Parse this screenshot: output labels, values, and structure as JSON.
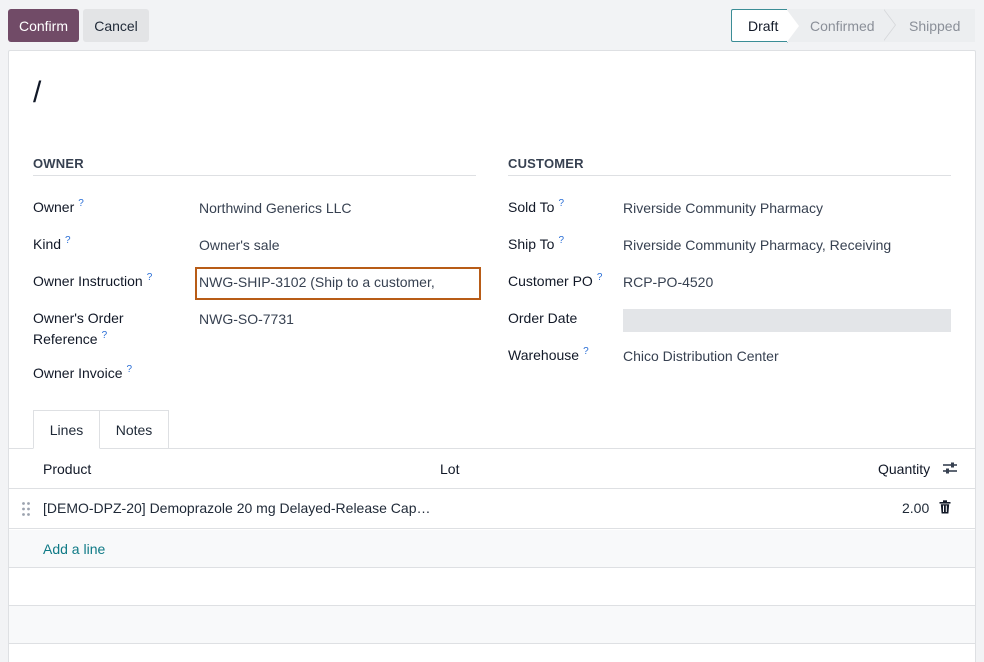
{
  "toolbar": {
    "confirm_label": "Confirm",
    "cancel_label": "Cancel"
  },
  "status": {
    "steps": [
      "Draft",
      "Confirmed",
      "Shipped"
    ],
    "active": "Draft"
  },
  "record": {
    "name": "/"
  },
  "owner_group": {
    "title": "OWNER",
    "fields": [
      {
        "label": "Owner",
        "help": "?",
        "value": "Northwind Generics LLC"
      },
      {
        "label": "Kind",
        "help": "?",
        "value": "Owner's sale"
      },
      {
        "label": "Owner Instruction",
        "help": "?",
        "value": "NWG-SHIP-3102 (Ship to a customer,"
      },
      {
        "label": "Owner's Order",
        "label2": "Reference",
        "help": "?",
        "value": "NWG-SO-7731"
      },
      {
        "label": "Owner Invoice",
        "help": "?",
        "value": ""
      }
    ]
  },
  "customer_group": {
    "title": "CUSTOMER",
    "fields": [
      {
        "label": "Sold To",
        "help": "?",
        "value": "Riverside Community Pharmacy"
      },
      {
        "label": "Ship To",
        "help": "?",
        "value": "Riverside Community Pharmacy, Receiving"
      },
      {
        "label": "Customer PO",
        "help": "?",
        "value": "RCP-PO-4520"
      },
      {
        "label": "Order Date",
        "help": "",
        "value": ""
      },
      {
        "label": "Warehouse",
        "help": "?",
        "value": "Chico Distribution Center"
      }
    ]
  },
  "tabs": [
    {
      "label": "Lines",
      "active": true
    },
    {
      "label": "Notes",
      "active": false
    }
  ],
  "lines_table": {
    "headers": {
      "product": "Product",
      "lot": "Lot",
      "quantity": "Quantity"
    },
    "rows": [
      {
        "product": "[DEMO-DPZ-20] Demoprazole 20 mg Delayed-Release Cap…",
        "lot": "",
        "quantity": "2.00"
      }
    ],
    "add_line_label": "Add a line"
  },
  "icons": {
    "drag": "drag-handle-icon",
    "delete": "trash-icon",
    "optional_columns": "sliders-icon"
  },
  "colors": {
    "primary": "#714b67",
    "link": "#0f7a86",
    "status_active_border": "#3b8d96",
    "highlight_border": "#b85c17"
  }
}
